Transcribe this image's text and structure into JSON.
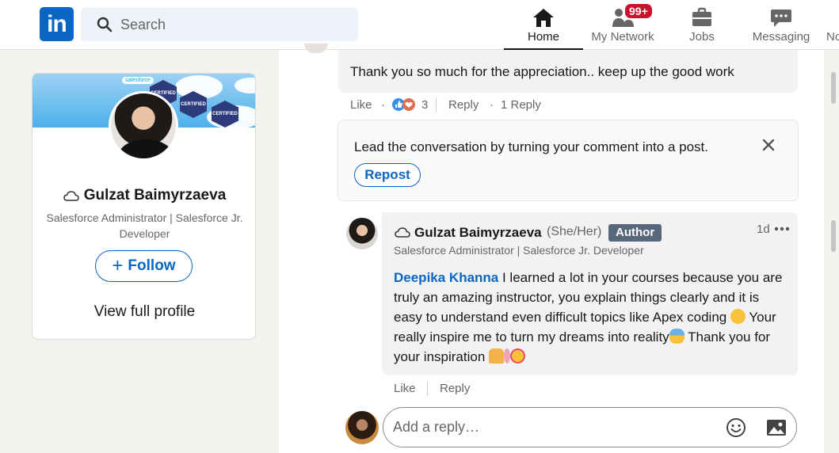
{
  "nav": {
    "logo_text": "in",
    "search_placeholder": "Search",
    "items": [
      {
        "label": "Home",
        "icon": "home-icon",
        "active": true
      },
      {
        "label": "My Network",
        "icon": "network-icon",
        "badge": "99+"
      },
      {
        "label": "Jobs",
        "icon": "briefcase-icon"
      },
      {
        "label": "Messaging",
        "icon": "messaging-icon"
      },
      {
        "label": "No",
        "icon": "notifications-icon"
      }
    ]
  },
  "profile_card": {
    "banner_logo": "salesforce",
    "cert_labels": [
      "CERTIFIED",
      "CERTIFIED",
      "CERTIFIED"
    ],
    "name": "Gulzat Baimyrzaeva",
    "headline": "Salesforce Administrator | Salesforce Jr. Developer",
    "follow_label": "Follow",
    "view_profile_label": "View full profile"
  },
  "comment": {
    "text": "Thank you so much for the appreciation.. keep up the good work",
    "like_label": "Like",
    "reaction_count": "3",
    "reply_label": "Reply",
    "replies_label": "1 Reply"
  },
  "repost_prompt": {
    "message": "Lead the conversation by turning your comment into a post.",
    "button_label": "Repost"
  },
  "reply": {
    "name": "Gulzat Baimyrzaeva",
    "pronouns": "(She/Her)",
    "badge": "Author",
    "time": "1d",
    "headline": "Salesforce Administrator | Salesforce Jr. Developer",
    "mention": "Deepika Khanna",
    "body_1": " I learned a lot in your courses because you are truly an amazing instructor, you explain things clearly and it is easy to understand even difficult topics like Apex coding ",
    "body_2": " Your really inspire me to turn my dreams into reality",
    "body_3": " Thank you for your inspiration ",
    "like_label": "Like",
    "reply_label": "Reply"
  },
  "reply_input": {
    "placeholder": "Add a reply…"
  },
  "colors": {
    "brand_blue": "#0a66c2",
    "badge_red": "#cb112d",
    "author_badge": "#56687a"
  }
}
